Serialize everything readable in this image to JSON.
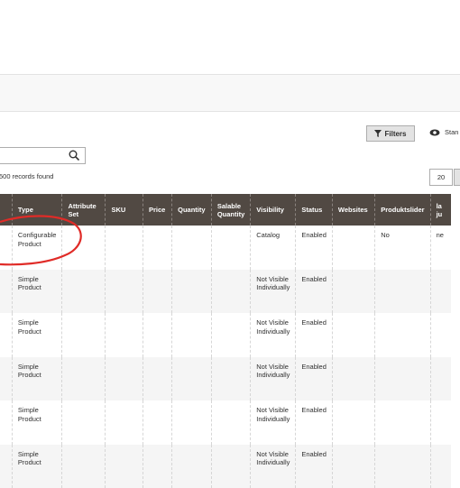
{
  "toolbar": {
    "filters_label": "Filters",
    "view_label": "Stan",
    "records_text": "500 records found",
    "per_page": "20"
  },
  "grid": {
    "columns": [
      "",
      "Type",
      "Attribute Set",
      "SKU",
      "Price",
      "Quantity",
      "Salable Quantity",
      "Visibility",
      "Status",
      "Websites",
      "Produktslider",
      "la ju"
    ],
    "rows": [
      {
        "type": "Configurable Product",
        "visibility": "Catalog",
        "status": "Enabled",
        "produktslider": "No",
        "last": "ne"
      },
      {
        "type": "Simple Product",
        "visibility": "Not Visible Individually",
        "status": "Enabled",
        "produktslider": "",
        "last": ""
      },
      {
        "type": "Simple Product",
        "visibility": "Not Visible Individually",
        "status": "Enabled",
        "produktslider": "",
        "last": ""
      },
      {
        "type": "Simple Product",
        "visibility": "Not Visible Individually",
        "status": "Enabled",
        "produktslider": "",
        "last": ""
      },
      {
        "type": "Simple Product",
        "visibility": "Not Visible Individually",
        "status": "Enabled",
        "produktslider": "",
        "last": ""
      },
      {
        "type": "Simple Product",
        "visibility": "Not Visible Individually",
        "status": "Enabled",
        "produktslider": "",
        "last": ""
      }
    ]
  },
  "annotation": {
    "color": "#e02b27"
  }
}
